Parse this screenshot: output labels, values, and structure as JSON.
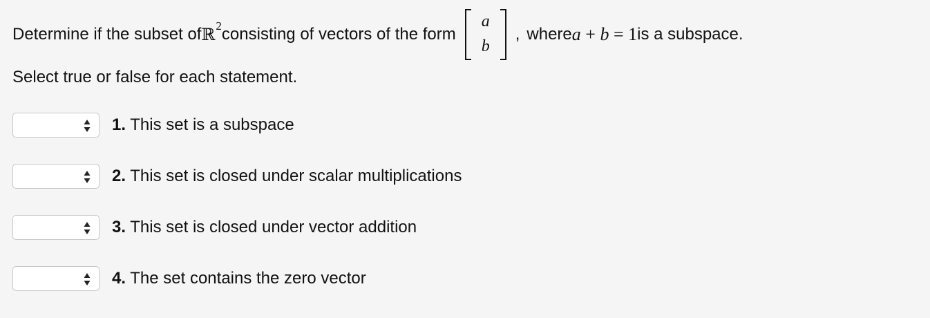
{
  "question": {
    "before_r": "Determine if the subset of ",
    "r_symbol": "ℝ",
    "r_exponent": "2",
    "middle": " consisting of vectors of the form",
    "matrix_top": "a",
    "matrix_bottom": "b",
    "comma": ",",
    "where": "where ",
    "var_a": "a",
    "plus": " + ",
    "var_b": "b",
    "equals": " = ",
    "one": "1",
    "ending": " is a subspace."
  },
  "instruction": "Select true or false for each statement.",
  "statements": [
    {
      "number": "1.",
      "text": " This set is a subspace",
      "selected": ""
    },
    {
      "number": "2.",
      "text": " This set is closed under scalar multiplications",
      "selected": ""
    },
    {
      "number": "3.",
      "text": " This set is closed under vector addition",
      "selected": ""
    },
    {
      "number": "4.",
      "text": " The set contains the zero vector",
      "selected": ""
    }
  ],
  "icons": {
    "dropdown": "up-down-chevron-icon"
  },
  "colors": {
    "background": "#f5f5f5",
    "select_border": "#c8c8c8",
    "select_fill": "#ffffff"
  }
}
